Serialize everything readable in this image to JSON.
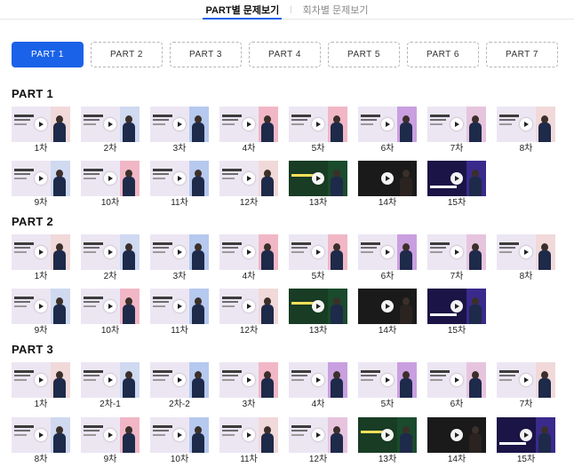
{
  "tabs": [
    {
      "label": "PART별 문제보기",
      "active": true
    },
    {
      "label": "회차별 문제보기",
      "active": false
    }
  ],
  "part_buttons": [
    "PART 1",
    "PART 2",
    "PART 3",
    "PART 4",
    "PART 5",
    "PART 6",
    "PART 7"
  ],
  "active_part_button": "PART 1",
  "sections": [
    {
      "title": "PART 1",
      "rows": [
        [
          {
            "label": "1차",
            "duration": "",
            "style": "light",
            "band": 0
          },
          {
            "label": "2차",
            "duration": "",
            "style": "light",
            "band": 2
          },
          {
            "label": "3차",
            "duration": "",
            "style": "light",
            "band": 3
          },
          {
            "label": "4차",
            "duration": "",
            "style": "light",
            "band": 1
          },
          {
            "label": "5차",
            "duration": "",
            "style": "light",
            "band": 1
          },
          {
            "label": "6차",
            "duration": "",
            "style": "light",
            "band": 4
          },
          {
            "label": "7차",
            "duration": "",
            "style": "light",
            "band": 5
          },
          {
            "label": "8차",
            "duration": "",
            "style": "light",
            "band": 0
          }
        ],
        [
          {
            "label": "9차",
            "duration": "",
            "style": "light",
            "band": 2
          },
          {
            "label": "10차",
            "duration": "",
            "style": "light",
            "band": 1
          },
          {
            "label": "11차",
            "duration": "",
            "style": "light",
            "band": 3
          },
          {
            "label": "12차",
            "duration": "",
            "style": "light",
            "band": 0
          },
          {
            "label": "13차",
            "duration": "",
            "style": "green",
            "band": 0
          },
          {
            "label": "14차",
            "duration": "",
            "style": "dark",
            "band": 0
          },
          {
            "label": "15차",
            "duration": "",
            "style": "purple",
            "band": 0
          }
        ]
      ]
    },
    {
      "title": "PART 2",
      "rows": [
        [
          {
            "label": "1차",
            "duration": "",
            "style": "light",
            "band": 0
          },
          {
            "label": "2차",
            "duration": "",
            "style": "light",
            "band": 2
          },
          {
            "label": "3차",
            "duration": "",
            "style": "light",
            "band": 3
          },
          {
            "label": "4차",
            "duration": "",
            "style": "light",
            "band": 1
          },
          {
            "label": "5차",
            "duration": "",
            "style": "light",
            "band": 1
          },
          {
            "label": "6차",
            "duration": "",
            "style": "light",
            "band": 4
          },
          {
            "label": "7차",
            "duration": "",
            "style": "light",
            "band": 5
          },
          {
            "label": "8차",
            "duration": "",
            "style": "light",
            "band": 0
          }
        ],
        [
          {
            "label": "9차",
            "duration": "",
            "style": "light",
            "band": 2
          },
          {
            "label": "10차",
            "duration": "",
            "style": "light",
            "band": 1
          },
          {
            "label": "11차",
            "duration": "",
            "style": "light",
            "band": 3
          },
          {
            "label": "12차",
            "duration": "",
            "style": "light",
            "band": 0
          },
          {
            "label": "13차",
            "duration": "",
            "style": "green",
            "band": 0
          },
          {
            "label": "14차",
            "duration": "",
            "style": "dark",
            "band": 0
          },
          {
            "label": "15차",
            "duration": "",
            "style": "purple",
            "band": 0
          }
        ]
      ]
    },
    {
      "title": "PART 3",
      "rows": [
        [
          {
            "label": "1차",
            "duration": "",
            "style": "light",
            "band": 0
          },
          {
            "label": "2차-1",
            "duration": "",
            "style": "light",
            "band": 2
          },
          {
            "label": "2차-2",
            "duration": "",
            "style": "light",
            "band": 3
          },
          {
            "label": "3차",
            "duration": "",
            "style": "light",
            "band": 1
          },
          {
            "label": "4차",
            "duration": "",
            "style": "light",
            "band": 4
          },
          {
            "label": "5차",
            "duration": "",
            "style": "light",
            "band": 4
          },
          {
            "label": "6차",
            "duration": "",
            "style": "light",
            "band": 5
          },
          {
            "label": "7차",
            "duration": "",
            "style": "light",
            "band": 0
          }
        ],
        [
          {
            "label": "8차",
            "duration": "",
            "style": "light",
            "band": 2
          },
          {
            "label": "9차",
            "duration": "",
            "style": "light",
            "band": 1
          },
          {
            "label": "10차",
            "duration": "",
            "style": "light",
            "band": 3
          },
          {
            "label": "11차",
            "duration": "",
            "style": "light",
            "band": 0
          },
          {
            "label": "12차",
            "duration": "",
            "style": "light",
            "band": 5
          },
          {
            "label": "13차",
            "duration": "",
            "style": "green",
            "band": 0
          },
          {
            "label": "14차",
            "duration": "",
            "style": "dark",
            "band": 0
          },
          {
            "label": "15차",
            "duration": "",
            "style": "purple",
            "band": 0
          }
        ]
      ]
    }
  ],
  "colors": {
    "accent": "#1a62e8",
    "text": "#222222",
    "dashed_border": "#b5b5b5"
  }
}
